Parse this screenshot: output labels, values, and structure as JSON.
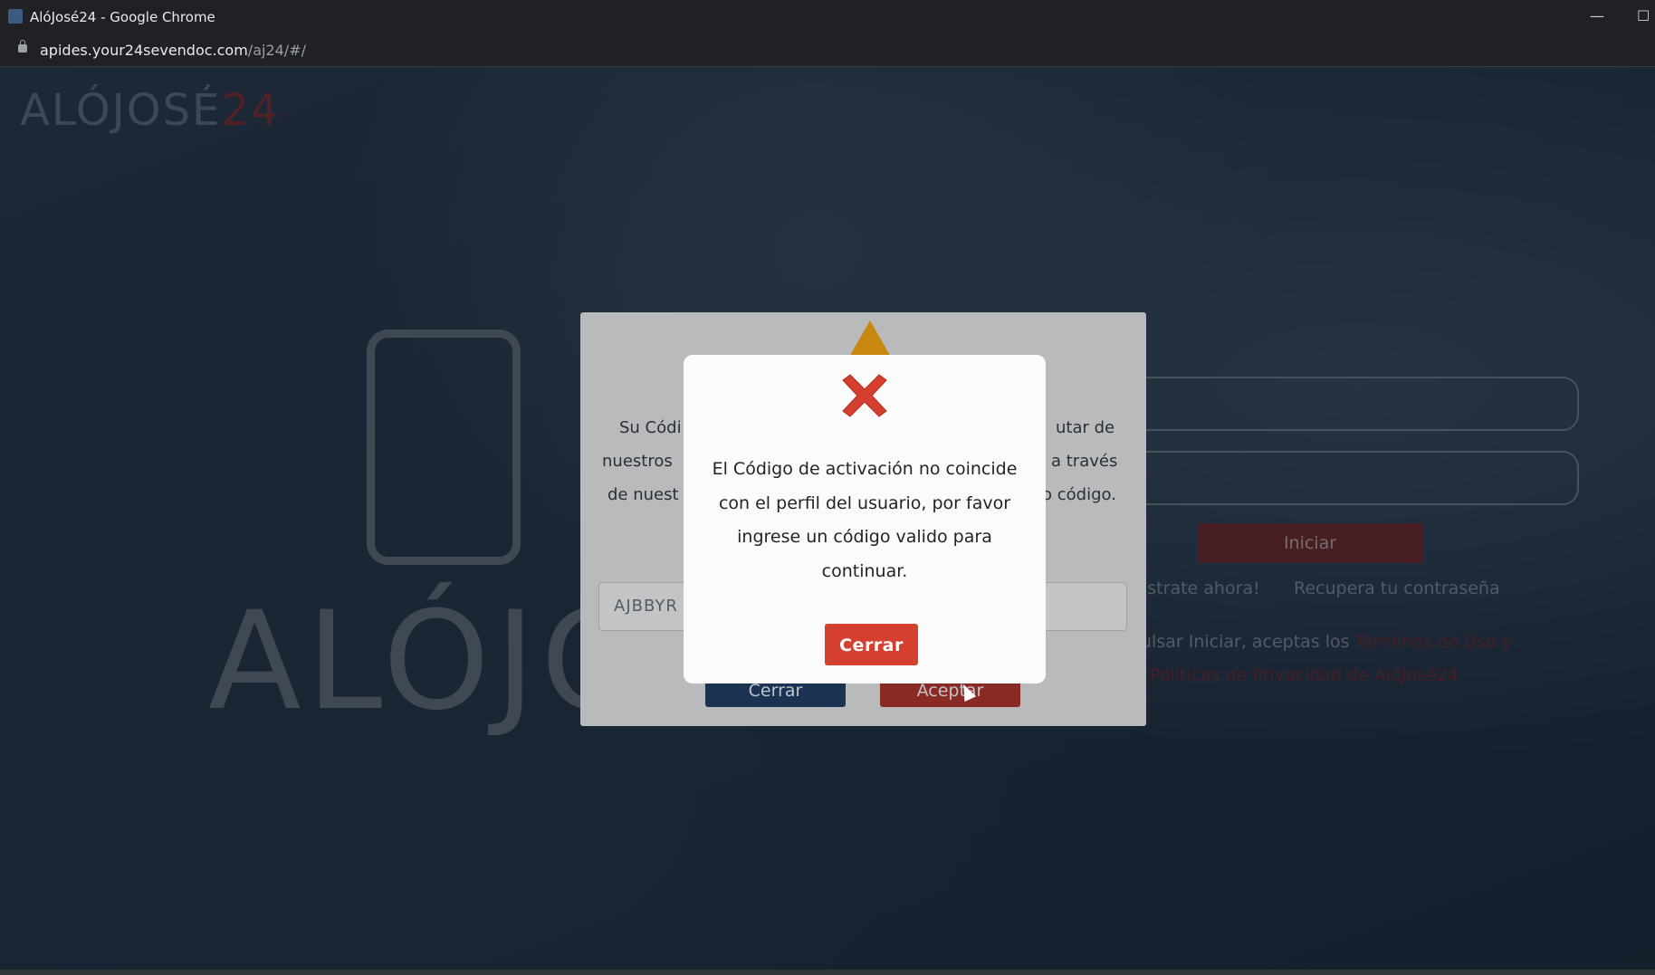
{
  "browser": {
    "window_title": "AlóJosé24 - Google Chrome",
    "url_host": "apides.your24sevendoc.com",
    "url_path": "/aj24/#/",
    "minimize_label": "—",
    "maximize_label": "☐"
  },
  "background_page": {
    "logo_text": "ALÓJOSÉ",
    "logo_number": "24",
    "big_logo_text": "ALÓJOSÉ",
    "login_button": "Iniciar",
    "register_link": "¡Regístrate ahora!",
    "register_visible": "istrate ahora!",
    "recover_link": "Recupera tu contraseña",
    "terms_prefix": "ulsar Iniciar, aceptas los ",
    "terms_link": "Terminos de Uso y",
    "privacy_link": "Políticas de Privacidad de AlóJosé24",
    "accent_color": "#7a2b27"
  },
  "activation_modal": {
    "text_line1_left": "Su Códi",
    "text_line1_right": "utar de",
    "text_line2_left": "nuestros",
    "text_line2_right": "a través",
    "text_line3_left": "de nuest",
    "text_line3_right": "o código.",
    "code_value": "AJBBYR",
    "close_button": "Cerrar",
    "accept_button": "Aceptar",
    "close_button_color": "#1b3352",
    "accept_button_color": "#8a2a24"
  },
  "error_modal": {
    "icon": "close-x-icon",
    "icon_color": "#d43f2f",
    "message": "El Código de activación no coincide con el perfil del usuario, por favor ingrese un código valido para continuar.",
    "close_button": "Cerrar",
    "close_button_color": "#d43f2f"
  }
}
